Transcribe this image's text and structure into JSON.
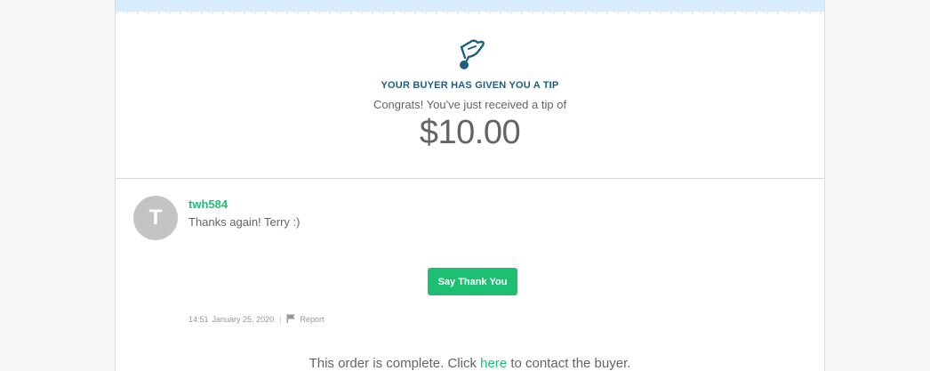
{
  "tip": {
    "icon": "hand-coin-icon",
    "heading": "YOUR BUYER HAS GIVEN YOU A TIP",
    "subtext": "Congrats! You've just received a tip of",
    "amount": "$10.00"
  },
  "message": {
    "avatar_letter": "T",
    "username": "twh584",
    "text": "Thanks again! Terry :)"
  },
  "actions": {
    "thank_button_label": "Say Thank You"
  },
  "meta": {
    "time": "14:51",
    "date": "January 25, 2020",
    "report_label": "Report"
  },
  "footer": {
    "text_before": "This order is complete. Click ",
    "link_text": "here",
    "text_after": " to contact the buyer."
  },
  "colors": {
    "accent_green": "#1dbf73",
    "heading_blue": "#1c5f80",
    "banner_blue": "#d9ecfb"
  }
}
